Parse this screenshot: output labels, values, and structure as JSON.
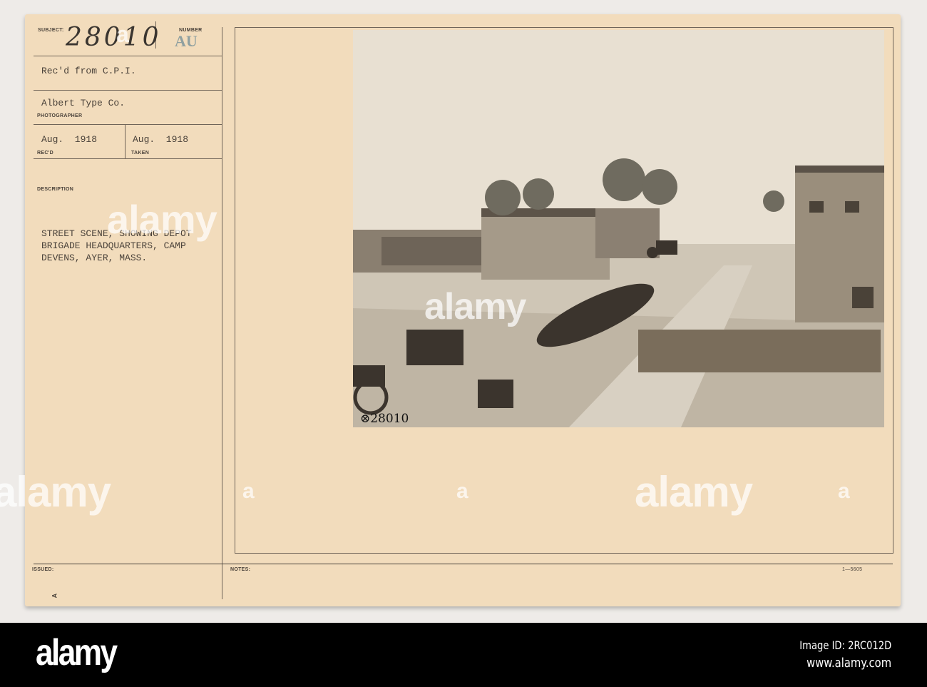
{
  "card": {
    "subject_label": "SUBJECT:",
    "subject_number": "28010",
    "number_label": "NUMBER",
    "number_stamp": "AU",
    "received_from": "Rec'd from C.P.I.",
    "photographer": "Albert Type Co.",
    "photographer_label": "PHOTOGRAPHER",
    "recd_date": "Aug.  1918",
    "recd_label": "REC'D",
    "taken_date": "Aug.  1918",
    "taken_label": "TAKEN",
    "description_label": "DESCRIPTION",
    "description": "STREET SCENE, SHOWING DEPOT\nBRIGADE HEADQUARTERS, CAMP\nDEVENS, AYER, MASS.",
    "issued_label": "ISSUED:",
    "notes_label": "NOTES:",
    "form_number": "1—5605",
    "corner_mark": "A",
    "photo_caption": "⊗28010"
  },
  "watermark": {
    "text": "alamy",
    "letter": "a"
  },
  "footer": {
    "logo": "alamy",
    "image_id": "Image ID: 2RC012D",
    "url": "www.alamy.com"
  }
}
